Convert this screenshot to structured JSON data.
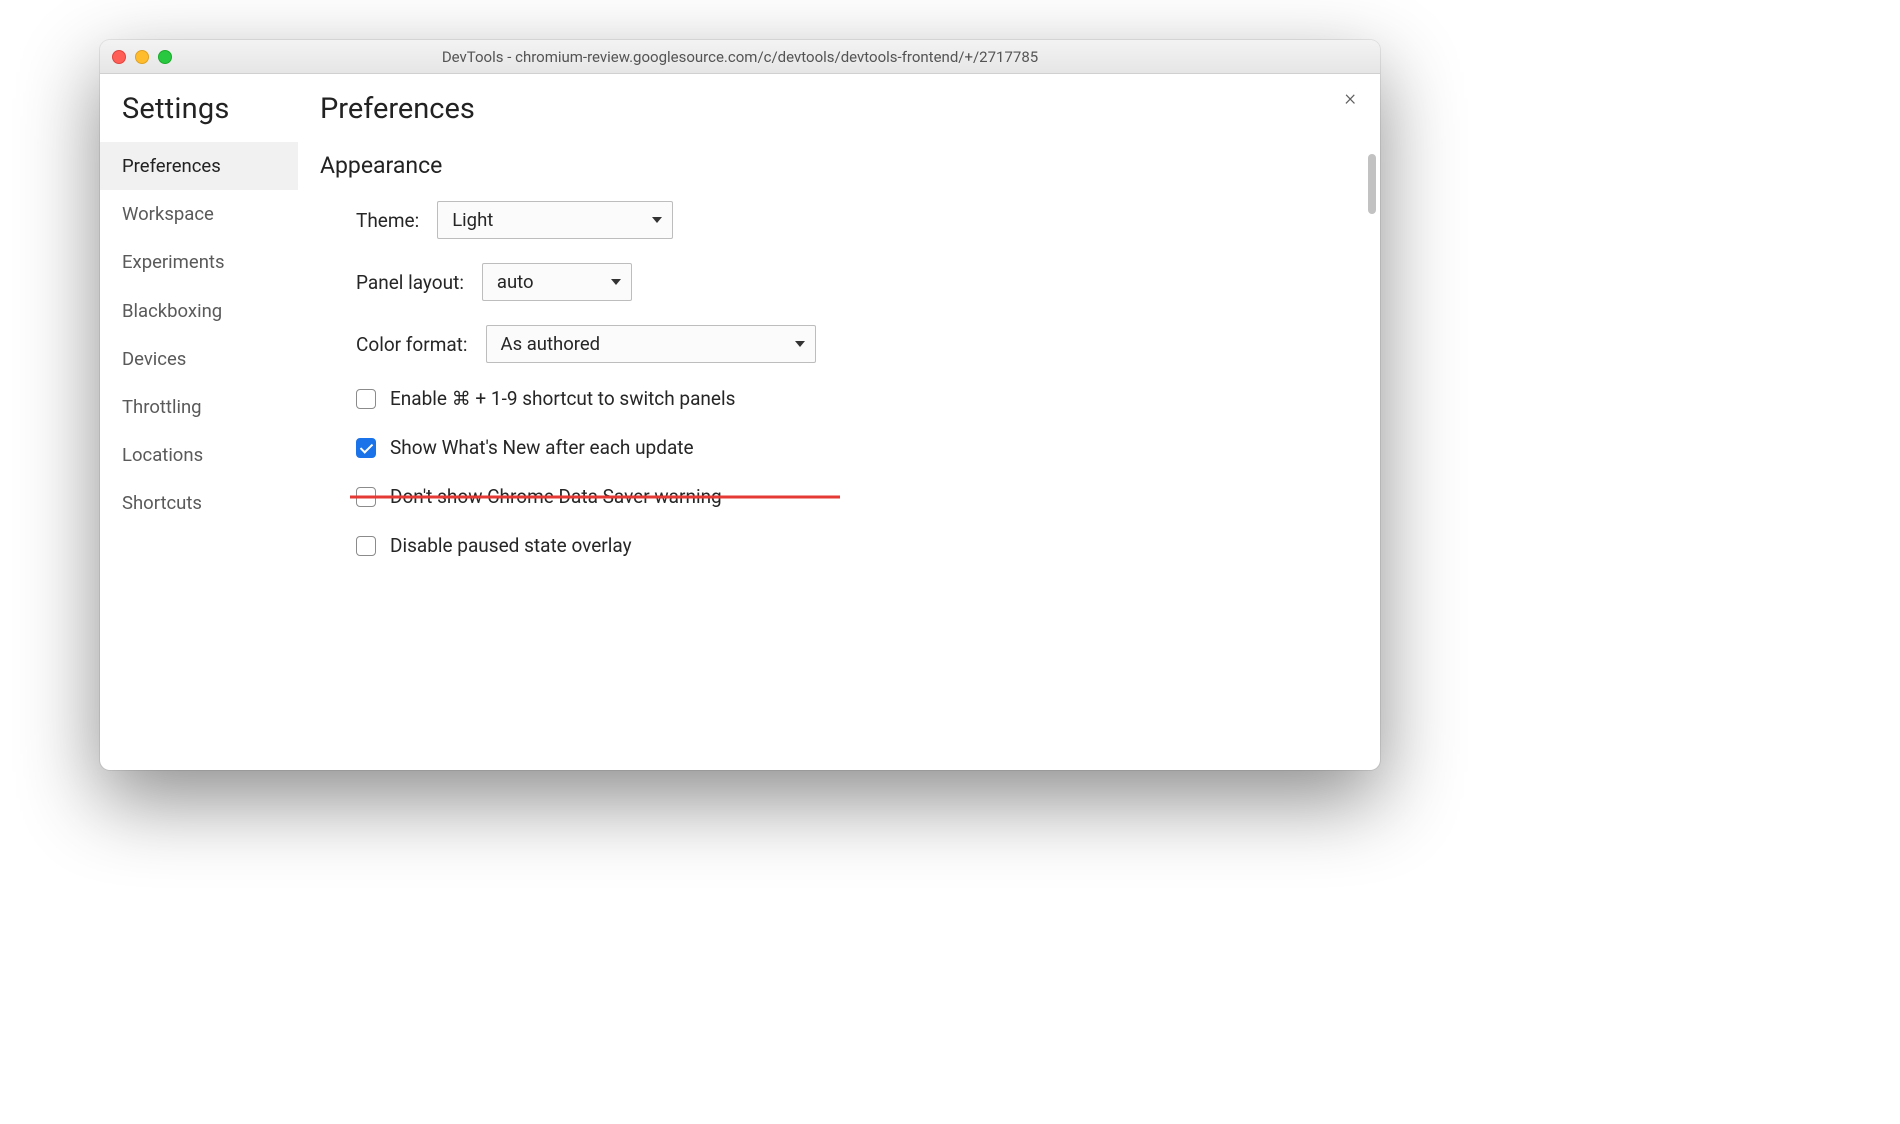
{
  "window": {
    "title": "DevTools - chromium-review.googlesource.com/c/devtools/devtools-frontend/+/2717785"
  },
  "sidebar": {
    "title": "Settings",
    "items": [
      {
        "label": "Preferences",
        "active": true
      },
      {
        "label": "Workspace",
        "active": false
      },
      {
        "label": "Experiments",
        "active": false
      },
      {
        "label": "Blackboxing",
        "active": false
      },
      {
        "label": "Devices",
        "active": false
      },
      {
        "label": "Throttling",
        "active": false
      },
      {
        "label": "Locations",
        "active": false
      },
      {
        "label": "Shortcuts",
        "active": false
      }
    ]
  },
  "main": {
    "title": "Preferences",
    "section_title": "Appearance",
    "theme_label": "Theme:",
    "theme_value": "Light",
    "panel_layout_label": "Panel layout:",
    "panel_layout_value": "auto",
    "color_format_label": "Color format:",
    "color_format_value": "As authored",
    "checkboxes": [
      {
        "label": "Enable ⌘ + 1-9 shortcut to switch panels",
        "checked": false,
        "struck": false
      },
      {
        "label": "Show What's New after each update",
        "checked": true,
        "struck": false
      },
      {
        "label": "Don't show Chrome Data Saver warning",
        "checked": false,
        "struck": true
      },
      {
        "label": "Disable paused state overlay",
        "checked": false,
        "struck": false
      }
    ]
  },
  "close_glyph": "×"
}
